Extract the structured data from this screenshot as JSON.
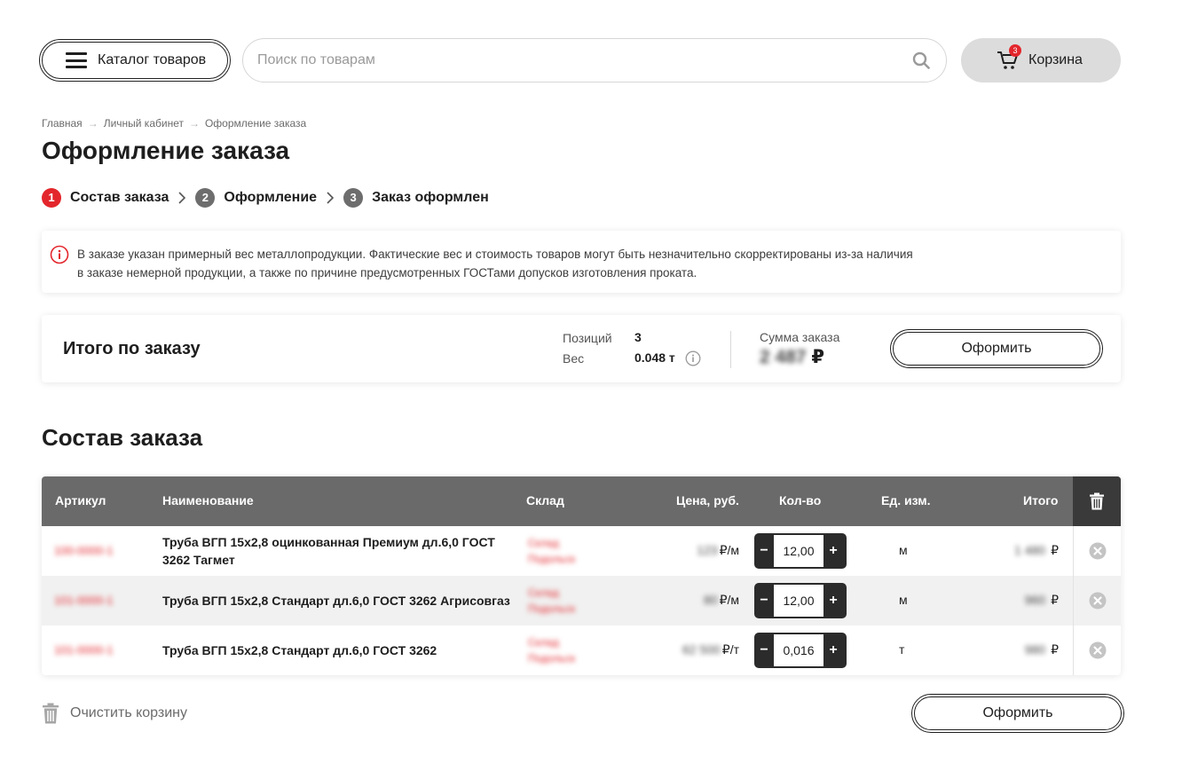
{
  "header": {
    "catalog_label": "Каталог товаров",
    "search_placeholder": "Поиск по товарам",
    "cart_label": "Корзина",
    "cart_count": "3"
  },
  "breadcrumb": [
    "Главная",
    "Личный кабинет",
    "Оформление заказа"
  ],
  "page_title": "Оформление заказа",
  "steps": [
    {
      "num": "1",
      "label": "Состав заказа",
      "active": true
    },
    {
      "num": "2",
      "label": "Оформление",
      "active": false
    },
    {
      "num": "3",
      "label": "Заказ оформлен",
      "active": false
    }
  ],
  "notice": {
    "line1": "В заказе указан примерный вес металлопродукции. Фактические вес и стоимость товаров могут быть незначительно скорректированы из-за наличия",
    "line2": "в заказе немерной продукции, а также по причине предусмотренных ГОСТами допусков изготовления проката."
  },
  "summary": {
    "title": "Итого по заказу",
    "positions_label": "Позиций",
    "positions_value": "3",
    "weight_label": "Вес",
    "weight_value": "0.048 т",
    "sum_label": "Сумма заказа",
    "sum_value": "2 487",
    "currency": "₽",
    "checkout_label": "Оформить"
  },
  "section_title": "Состав заказа",
  "table": {
    "headers": {
      "article": "Артикул",
      "name": "Наименование",
      "warehouse": "Склад",
      "price": "Цена, руб.",
      "qty": "Кол-во",
      "unit": "Ед. изм.",
      "total": "Итого"
    },
    "rows": [
      {
        "article": "100-0000-1",
        "name": "Труба ВГП 15х2,8 оцинкованная Премиум дл.6,0 ГОСТ 3262 Тагмет",
        "wh1": "Склад",
        "wh2": "Подольск",
        "price": "123",
        "price_unit": "₽/м",
        "qty": "12,00",
        "unit": "м",
        "total": "1 480",
        "currency": "₽"
      },
      {
        "article": "101-0000-1",
        "name": "Труба ВГП 15х2,8 Стандарт дл.6,0 ГОСТ 3262 Агрисовгаз",
        "wh1": "Склад",
        "wh2": "Подольск",
        "price": "80",
        "price_unit": "₽/м",
        "qty": "12,00",
        "unit": "м",
        "total": "960",
        "currency": "₽"
      },
      {
        "article": "101-0000-1",
        "name": "Труба ВГП 15х2,8 Стандарт дл.6,0 ГОСТ 3262",
        "wh1": "Склад",
        "wh2": "Подольск",
        "price": "62 500",
        "price_unit": "₽/т",
        "qty": "0,016",
        "unit": "т",
        "total": "980",
        "currency": "₽"
      }
    ]
  },
  "clear_cart_label": "Очистить корзину",
  "bottom_checkout_label": "Оформить",
  "colors": {
    "accent": "#e3262c",
    "header_bg": "#6a6a6a",
    "trash_bg": "#3a3a3a"
  }
}
